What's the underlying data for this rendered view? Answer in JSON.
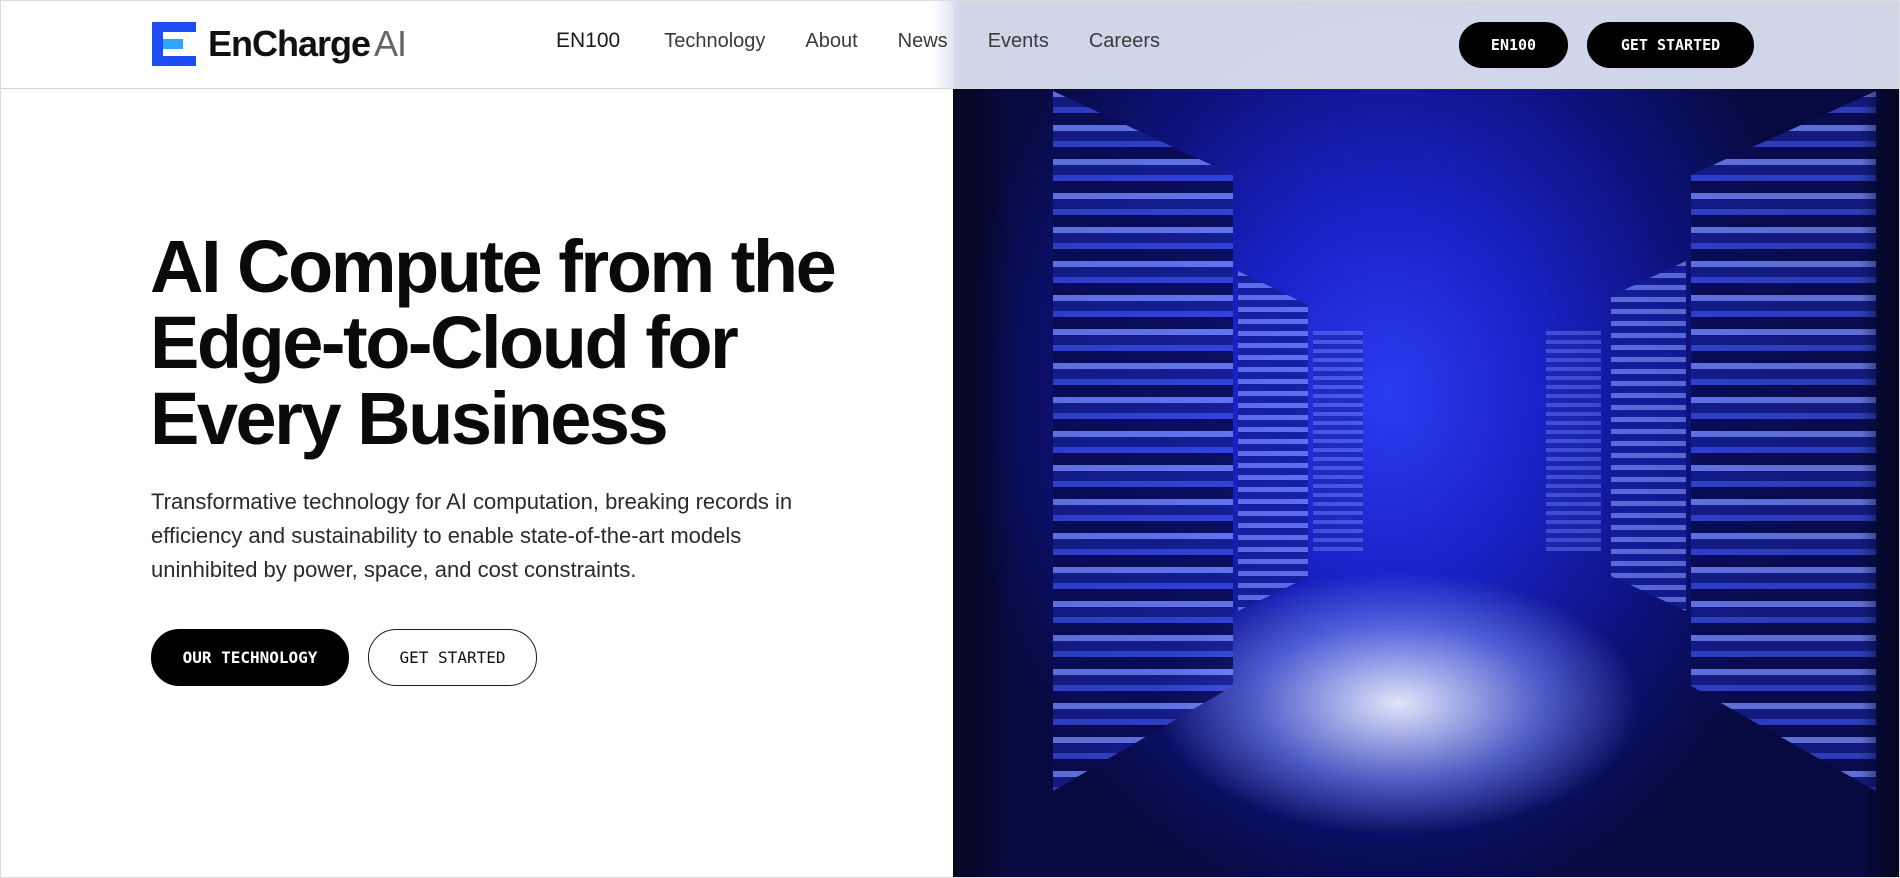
{
  "brand": {
    "name": "EnCharge",
    "suffix": "AI",
    "accent_color": "#1f4df5",
    "accent_light": "#2fa6ff"
  },
  "nav": {
    "items": [
      {
        "label": "EN100"
      },
      {
        "label": "Technology"
      },
      {
        "label": "About"
      },
      {
        "label": "News"
      },
      {
        "label": "Events"
      },
      {
        "label": "Careers"
      }
    ]
  },
  "header_actions": {
    "product_button": "EN100",
    "get_started_button": "GET STARTED"
  },
  "hero": {
    "headline": "AI Compute from the Edge-to-Cloud for Every Business",
    "subtext": "Transformative technology for AI computation, breaking records in efficiency and sustainability to enable state-of-the-art models uninhibited by power, space, and cost constraints.",
    "primary_cta": "OUR TECHNOLOGY",
    "secondary_cta": "GET STARTED",
    "image_subject": "server-room-blue-image"
  }
}
